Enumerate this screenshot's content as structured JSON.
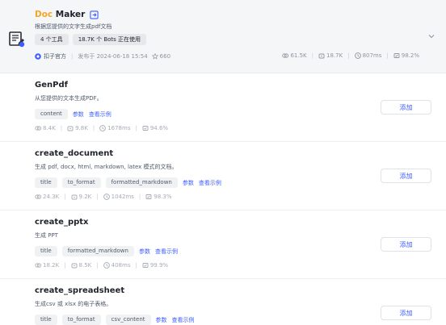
{
  "plugin": {
    "name_accent": "Doc",
    "name_rest": " Maker",
    "description": "根据您提供的文字生成pdf文档",
    "chips": [
      "4 个工具",
      "18.7K 个 Bots 正在使用"
    ],
    "author": "扣子官方",
    "published": "发布于 2024-06-18 15:54",
    "favorites": "660",
    "stats": {
      "calls": "61.5K",
      "bots": "18.7K",
      "latency": "807ms",
      "success": "98.2%"
    }
  },
  "tools": [
    {
      "name": "GenPdf",
      "description": "从您提供的文本生成PDF。",
      "params": [
        "content"
      ],
      "params_link": "参数",
      "example_link": "查看示例",
      "stats": {
        "calls": "8.4K",
        "bots": "9.8K",
        "latency": "1678ms",
        "success": "94.6%"
      },
      "add_label": "添加"
    },
    {
      "name": "create_document",
      "description": "生成 pdf, docx, html, markdown, latex 模式的文档。",
      "params": [
        "title",
        "to_format",
        "formatted_markdown"
      ],
      "params_link": "参数",
      "example_link": "查看示例",
      "stats": {
        "calls": "24.3K",
        "bots": "9.2K",
        "latency": "1042ms",
        "success": "98.3%"
      },
      "add_label": "添加"
    },
    {
      "name": "create_pptx",
      "description": "生成 PPT",
      "params": [
        "title",
        "formatted_markdown"
      ],
      "params_link": "参数",
      "example_link": "查看示例",
      "stats": {
        "calls": "18.2K",
        "bots": "8.5K",
        "latency": "408ms",
        "success": "99.9%"
      },
      "add_label": "添加"
    },
    {
      "name": "create_spreadsheet",
      "description": "生成csv 或 xlsx 的电子表格。",
      "params": [
        "title",
        "to_format",
        "csv_content"
      ],
      "params_link": "参数",
      "example_link": "查看示例",
      "stats": null,
      "add_label": "添加"
    }
  ],
  "colors": {
    "accent": "#f5a623",
    "link": "#3c5cff",
    "author_badge": "#3c5cff"
  }
}
